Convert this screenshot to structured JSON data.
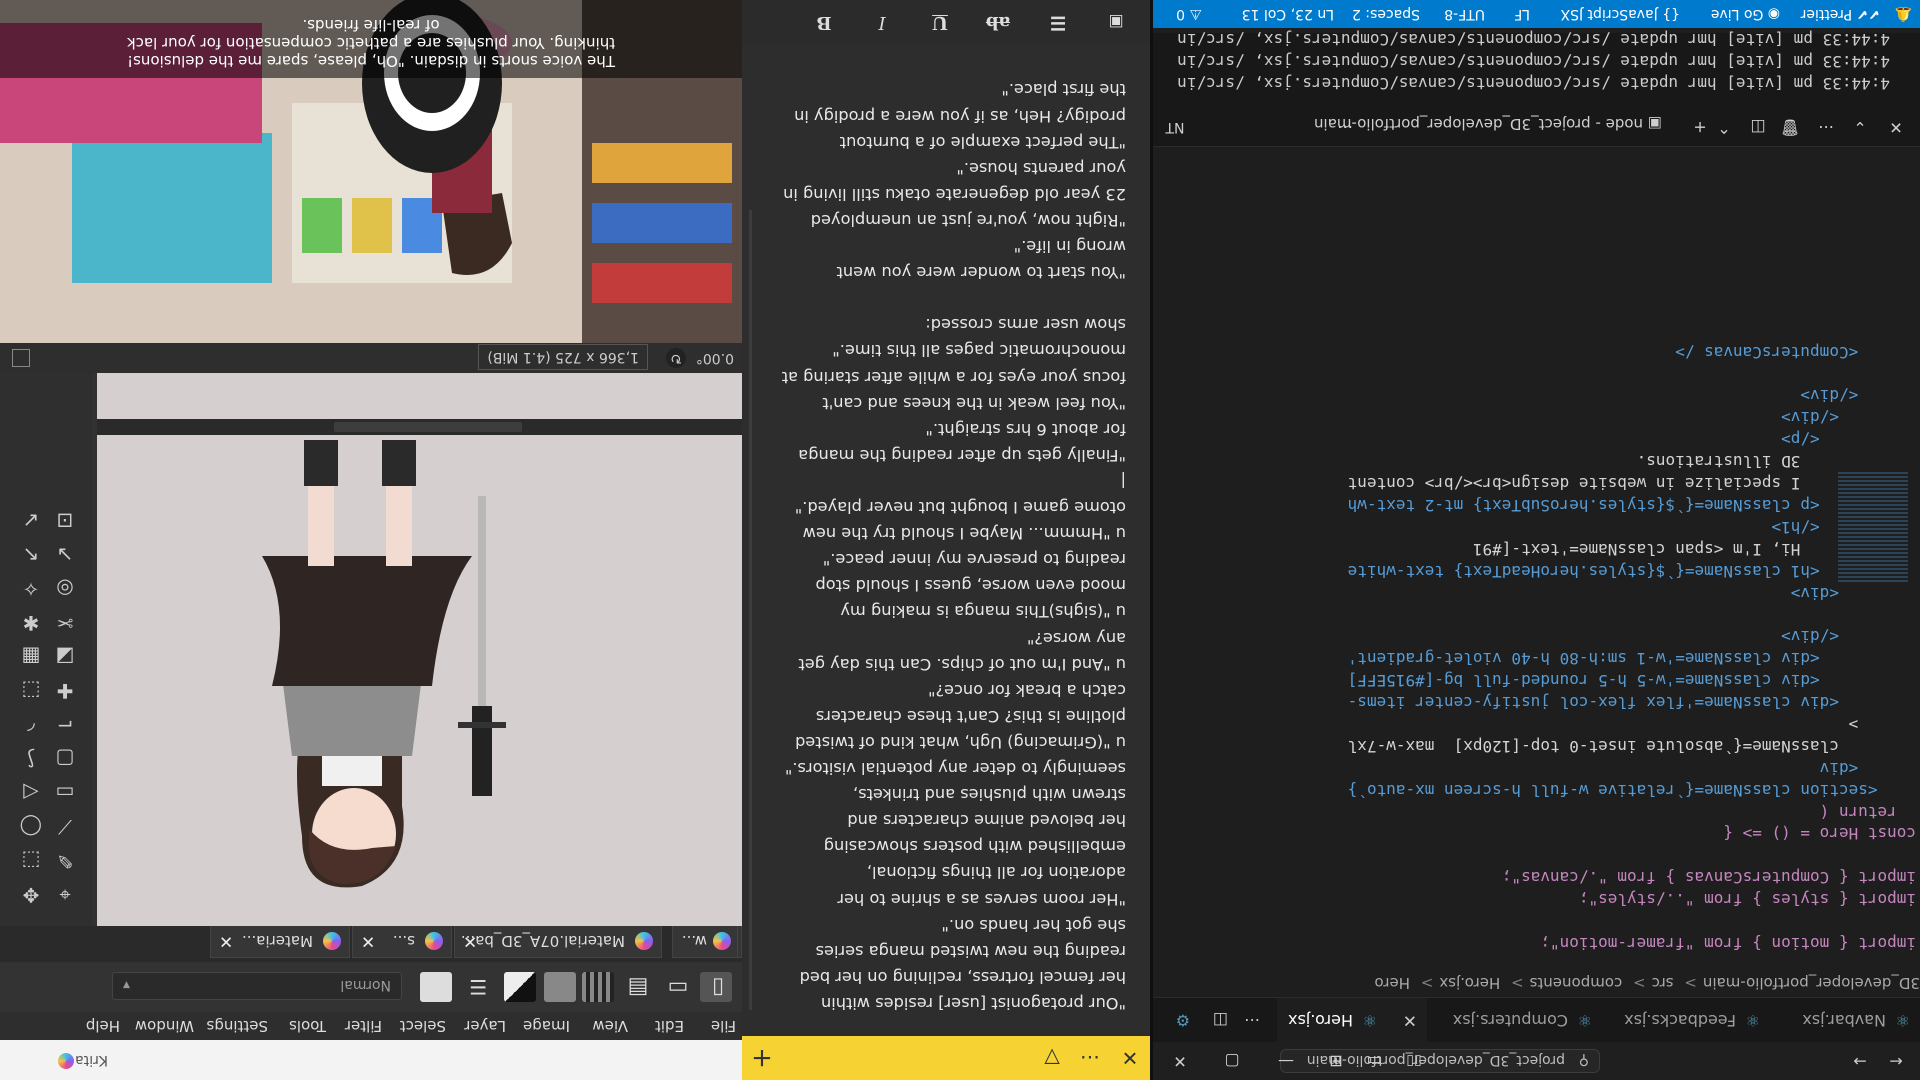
{
  "vscode": {
    "search": "project_3D_developer_portfolio-main",
    "tabs": [
      "Navbar.jsx",
      "Feedbacks.jsx",
      "Computers.jsx",
      "Hero.jsx"
    ],
    "breadcrumb": [
      "3D_developer_portfolio-main",
      "src",
      "components",
      "Hero.jsx",
      "Hero"
    ],
    "code": [
      {
        "t": "import { motion } from \"framer-motion\";"
      },
      {
        "t": ""
      },
      {
        "t": "import { styles } from \"../styles\";"
      },
      {
        "t": "import { ComputersCanvas } from \"./canvas\";"
      },
      {
        "t": ""
      },
      {
        "t": "const Hero = () => {"
      },
      {
        "t": "  return ("
      },
      {
        "t": "    <section className={`relative w-full h-screen mx-auto`}"
      },
      {
        "t": "      <div"
      },
      {
        "t": "        className={`absolute inset-0 top-[120px]  max-w-7xl"
      },
      {
        "t": "      >"
      },
      {
        "t": "        <div className='flex flex-col justify-center items-"
      },
      {
        "t": "          <div className='w-5 h-5 rounded-full bg-[#915EFF]"
      },
      {
        "t": "          <div className='w-1 sm:h-80 h-40 violet-gradient'"
      },
      {
        "t": "        </div>"
      },
      {
        "t": ""
      },
      {
        "t": "        <div>"
      },
      {
        "t": "          <h1 className={`${styles.heroHeadText} text-white"
      },
      {
        "t": "            Hi, I'm <span className='text-[#91"
      },
      {
        "t": "          </h1>"
      },
      {
        "t": "          <p className={`${styles.heroSubText} mt-2 text-wh"
      },
      {
        "t": "            I specialize in website design<br></br> content"
      },
      {
        "t": "            3D illustrations."
      },
      {
        "t": "          </p>"
      },
      {
        "t": "        </div>"
      },
      {
        "t": "      </div>"
      },
      {
        "t": ""
      },
      {
        "t": "      <ComputersCanvas />"
      }
    ],
    "panel_title": "node - project_3D_developer_portfolio-main",
    "panel_label": "NT",
    "terminal": [
      "4:44:33 pm [vite] hmr update /src/components/canvas/Computers.jsx, /src/in",
      "4:44:33 pm [vite] hmr update /src/components/canvas/Computers.jsx, /src/in",
      "4:44:33 pm [vite] hmr update /src/components/canvas/Computers.jsx, /src/in"
    ],
    "status": {
      "errors": "0",
      "position": "Ln 23, Col 13",
      "spaces": "Spaces: 2",
      "encoding": "UTF-8",
      "eol": "LF",
      "language": "JavaScript JSX",
      "golive": "Go Live",
      "prettier": "Prettier"
    }
  },
  "sticky": {
    "lines": [
      "\"Our protagonist [user] resides within",
      "her femcel fortress, reclining on her bed",
      "reading the new twisted manga series",
      "she got her hands on.\"",
      "  \"Her room serves as a shrine to her",
      "adoration for all things fictional,",
      "embellished with posters showcasing",
      "her beloved anime characters and",
      "strewn with plushies and trinkets,",
      "seemingly to deter any potential visitors.\"",
      "  u \"(Grimacing) Ugh, what kind of twisted",
      "plotline is this? Can't these characters",
      "catch a break for once?\"",
      "  u \"And I'm out of chips. Can this day get",
      "any worse?\"",
      "  u \"(sighs)This manga is making my",
      "mood even worse, guess I should stop",
      "reading to preserve my inner peace.\"",
      "  u \"Hmmm... Maybe I should try the new",
      "otome game I bought but never played.\"",
      "|",
      "  \"Finally gets up after reading the manga",
      "for about 6 hrs straight.\"",
      "  \"You feel weak in the knees and can't",
      "focus your eyes for a while after staring at",
      "monochromatic pages all this time.\"",
      "  show user arms crossed:",
      "",
      "  \"You start to wonder were you went",
      "wrong in life.\"",
      "  \"Right now, you're just an unemployed",
      "23 year old degenerate otaku still living in",
      "your parents house.\"",
      "  \"The perfect example of a burntout",
      "prodigy? Heh, as if you were a prodigy in",
      "the first place.\""
    ]
  },
  "krita": {
    "app_title": "Krita",
    "menu": [
      "File",
      "Edit",
      "View",
      "Image",
      "Layer",
      "Select",
      "Filter",
      "Tools",
      "Settings",
      "Window",
      "Help"
    ],
    "blend_mode": "Normal",
    "doc_tabs": [
      "Materia...",
      "s...",
      "Material.07A_3D_ba...",
      "w..."
    ],
    "status_size": "1,366 x 725 (4.1 MiB)",
    "status_rotation": "0.00°",
    "subtitle": [
      "The voice snorts in disdain. \"Oh, please, spare me the delusions!",
      "thinking. Your plushies are a pathetic compensation for your lack",
      "of real-life friends."
    ]
  },
  "colors": {
    "vs_status": "#007acc",
    "sticky_header": "#f6d333",
    "krita_bg": "#323232"
  }
}
